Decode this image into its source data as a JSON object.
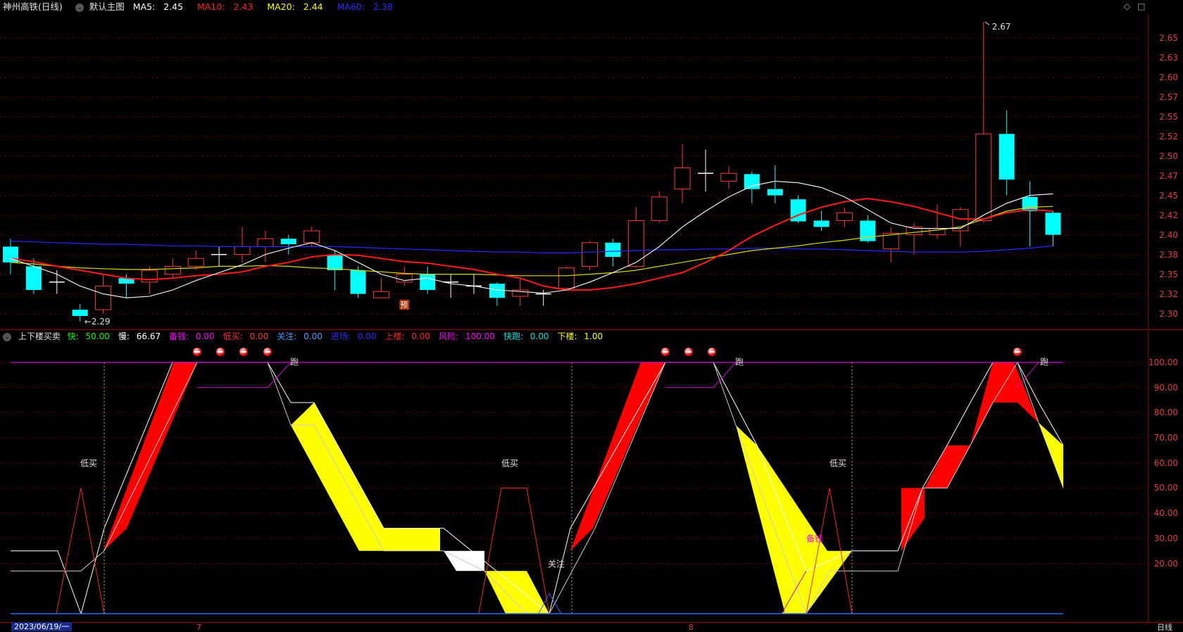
{
  "header": {
    "stock_name": "神州高铁(日线)",
    "main_chart_label": "默认主图",
    "ma": [
      {
        "label": "MA5:",
        "value": "2.45",
        "color": "#ffffff"
      },
      {
        "label": "MA10:",
        "value": "2.43",
        "color": "#ff2020"
      },
      {
        "label": "MA20:",
        "value": "2.44",
        "color": "#ffff00"
      },
      {
        "label": "MA60:",
        "value": "2.38",
        "color": "#2a2aff"
      }
    ],
    "window_icons": [
      "diamond-icon",
      "square-icon"
    ]
  },
  "price_axis": {
    "ticks": [
      "2.65",
      "2.63",
      "2.60",
      "2.57",
      "2.55",
      "2.52",
      "2.50",
      "2.47",
      "2.45",
      "2.42",
      "2.40",
      "2.38",
      "2.35",
      "2.32",
      "2.30"
    ],
    "tick_values": [
      2.65,
      2.625,
      2.6,
      2.575,
      2.55,
      2.525,
      2.5,
      2.475,
      2.45,
      2.425,
      2.4,
      2.375,
      2.35,
      2.325,
      2.3
    ],
    "high_label": "2.67",
    "low_label": "2.29",
    "preview_badge": "预"
  },
  "indicator": {
    "name": "上下楼买卖",
    "params": [
      {
        "label": "快:",
        "value": "50.00",
        "color": "#00ff00"
      },
      {
        "label": "慢:",
        "value": "66.67",
        "color": "#ffffff"
      },
      {
        "label": "备钱:",
        "value": "0.00",
        "color": "#ff00ff"
      },
      {
        "label": "低买:",
        "value": "0.00",
        "color": "#ff3030"
      },
      {
        "label": "关注:",
        "value": "0.00",
        "color": "#40a0ff"
      },
      {
        "label": "进场:",
        "value": "0.00",
        "color": "#2a2aff"
      },
      {
        "label": "上楼:",
        "value": "0.00",
        "color": "#ff2020"
      },
      {
        "label": "风险:",
        "value": "100.00",
        "color": "#ff00ff"
      },
      {
        "label": "快跑:",
        "value": "0.00",
        "color": "#00e0e0"
      },
      {
        "label": "下楼:",
        "value": "1.00",
        "color": "#ffff00"
      }
    ],
    "axis_ticks": [
      "100.00",
      "90.00",
      "80.00",
      "70.00",
      "60.00",
      "50.00",
      "40.00",
      "30.00",
      "20.00"
    ],
    "axis_values": [
      100,
      90,
      80,
      70,
      60,
      50,
      40,
      30,
      20
    ],
    "annotations": {
      "run": "跑",
      "low_buy": "低买",
      "watch": "关注",
      "prepare": "备钱"
    }
  },
  "footer": {
    "date": "2023/06/19/一",
    "month_7": "7",
    "month_8": "8",
    "period": "日线"
  },
  "chart_data": {
    "type": "candlestick",
    "title": "神州高铁(日线)",
    "candles": [
      {
        "o": 2.385,
        "c": 2.365,
        "h": 2.395,
        "l": 2.35
      },
      {
        "o": 2.36,
        "c": 2.33,
        "h": 2.37,
        "l": 2.325
      },
      {
        "o": 2.34,
        "c": 2.34,
        "h": 2.355,
        "l": 2.325
      },
      {
        "o": 2.305,
        "c": 2.297,
        "h": 2.312,
        "l": 2.29
      },
      {
        "o": 2.305,
        "c": 2.335,
        "h": 2.35,
        "l": 2.3
      },
      {
        "o": 2.345,
        "c": 2.338,
        "h": 2.35,
        "l": 2.32
      },
      {
        "o": 2.34,
        "c": 2.355,
        "h": 2.36,
        "l": 2.325
      },
      {
        "o": 2.35,
        "c": 2.36,
        "h": 2.37,
        "l": 2.345
      },
      {
        "o": 2.36,
        "c": 2.37,
        "h": 2.38,
        "l": 2.355
      },
      {
        "o": 2.375,
        "c": 2.375,
        "h": 2.385,
        "l": 2.36
      },
      {
        "o": 2.375,
        "c": 2.385,
        "h": 2.41,
        "l": 2.365
      },
      {
        "o": 2.385,
        "c": 2.395,
        "h": 2.405,
        "l": 2.365
      },
      {
        "o": 2.395,
        "c": 2.388,
        "h": 2.4,
        "l": 2.375
      },
      {
        "o": 2.39,
        "c": 2.405,
        "h": 2.41,
        "l": 2.385
      },
      {
        "o": 2.375,
        "c": 2.355,
        "h": 2.38,
        "l": 2.33
      },
      {
        "o": 2.355,
        "c": 2.325,
        "h": 2.36,
        "l": 2.32
      },
      {
        "o": 2.32,
        "c": 2.328,
        "h": 2.345,
        "l": 2.32
      },
      {
        "o": 2.34,
        "c": 2.35,
        "h": 2.36,
        "l": 2.335
      },
      {
        "o": 2.35,
        "c": 2.33,
        "h": 2.36,
        "l": 2.325
      },
      {
        "o": 2.34,
        "c": 2.34,
        "h": 2.35,
        "l": 2.32
      },
      {
        "o": 2.335,
        "c": 2.335,
        "h": 2.35,
        "l": 2.325
      },
      {
        "o": 2.338,
        "c": 2.32,
        "h": 2.34,
        "l": 2.31
      },
      {
        "o": 2.322,
        "c": 2.33,
        "h": 2.345,
        "l": 2.31
      },
      {
        "o": 2.325,
        "c": 2.325,
        "h": 2.33,
        "l": 2.31
      },
      {
        "o": 2.332,
        "c": 2.358,
        "h": 2.36,
        "l": 2.33
      },
      {
        "o": 2.36,
        "c": 2.39,
        "h": 2.392,
        "l": 2.355
      },
      {
        "o": 2.39,
        "c": 2.372,
        "h": 2.395,
        "l": 2.36
      },
      {
        "o": 2.36,
        "c": 2.418,
        "h": 2.435,
        "l": 2.358
      },
      {
        "o": 2.418,
        "c": 2.448,
        "h": 2.455,
        "l": 2.415
      },
      {
        "o": 2.458,
        "c": 2.485,
        "h": 2.515,
        "l": 2.44
      },
      {
        "o": 2.478,
        "c": 2.478,
        "h": 2.508,
        "l": 2.455
      },
      {
        "o": 2.468,
        "c": 2.478,
        "h": 2.487,
        "l": 2.458
      },
      {
        "o": 2.477,
        "c": 2.458,
        "h": 2.48,
        "l": 2.44
      },
      {
        "o": 2.458,
        "c": 2.45,
        "h": 2.488,
        "l": 2.44
      },
      {
        "o": 2.445,
        "c": 2.417,
        "h": 2.45,
        "l": 2.415
      },
      {
        "o": 2.418,
        "c": 2.41,
        "h": 2.43,
        "l": 2.405
      },
      {
        "o": 2.418,
        "c": 2.428,
        "h": 2.434,
        "l": 2.41
      },
      {
        "o": 2.418,
        "c": 2.392,
        "h": 2.425,
        "l": 2.39
      },
      {
        "o": 2.382,
        "c": 2.402,
        "h": 2.41,
        "l": 2.365
      },
      {
        "o": 2.4,
        "c": 2.41,
        "h": 2.415,
        "l": 2.375
      },
      {
        "o": 2.4,
        "c": 2.408,
        "h": 2.438,
        "l": 2.395
      },
      {
        "o": 2.405,
        "c": 2.432,
        "h": 2.435,
        "l": 2.385
      },
      {
        "o": 2.418,
        "c": 2.528,
        "h": 2.67,
        "l": 2.415
      },
      {
        "o": 2.528,
        "c": 2.47,
        "h": 2.558,
        "l": 2.45
      },
      {
        "o": 2.448,
        "c": 2.43,
        "h": 2.468,
        "l": 2.385
      },
      {
        "o": 2.428,
        "c": 2.4,
        "h": 2.43,
        "l": 2.385
      }
    ],
    "ma5": [
      2.37,
      2.36,
      2.35,
      2.335,
      2.325,
      2.32,
      2.322,
      2.33,
      2.342,
      2.352,
      2.362,
      2.375,
      2.383,
      2.39,
      2.38,
      2.365,
      2.35,
      2.342,
      2.345,
      2.338,
      2.335,
      2.33,
      2.328,
      2.326,
      2.33,
      2.34,
      2.352,
      2.365,
      2.385,
      2.41,
      2.43,
      2.448,
      2.462,
      2.468,
      2.466,
      2.46,
      2.448,
      2.432,
      2.415,
      2.408,
      2.408,
      2.408,
      2.425,
      2.44,
      2.45,
      2.452
    ],
    "ma10": [
      2.37,
      2.366,
      2.36,
      2.355,
      2.35,
      2.345,
      2.343,
      2.345,
      2.348,
      2.35,
      2.353,
      2.36,
      2.365,
      2.372,
      2.375,
      2.374,
      2.37,
      2.366,
      2.364,
      2.36,
      2.356,
      2.35,
      2.345,
      2.335,
      2.33,
      2.33,
      2.333,
      2.338,
      2.345,
      2.352,
      2.365,
      2.38,
      2.398,
      2.412,
      2.425,
      2.435,
      2.442,
      2.446,
      2.442,
      2.436,
      2.428,
      2.42,
      2.42,
      2.428,
      2.432,
      2.43
    ],
    "ma20": [
      2.365,
      2.363,
      2.36,
      2.358,
      2.357,
      2.356,
      2.356,
      2.357,
      2.358,
      2.36,
      2.36,
      2.361,
      2.36,
      2.358,
      2.357,
      2.355,
      2.353,
      2.351,
      2.35,
      2.35,
      2.35,
      2.349,
      2.348,
      2.348,
      2.348,
      2.35,
      2.352,
      2.355,
      2.36,
      2.365,
      2.37,
      2.375,
      2.38,
      2.383,
      2.386,
      2.39,
      2.393,
      2.397,
      2.4,
      2.403,
      2.406,
      2.41,
      2.42,
      2.43,
      2.435,
      2.436
    ],
    "ma60": [
      2.392,
      2.391,
      2.39,
      2.389,
      2.388,
      2.388,
      2.387,
      2.386,
      2.386,
      2.385,
      2.385,
      2.385,
      2.385,
      2.385,
      2.385,
      2.384,
      2.383,
      2.382,
      2.381,
      2.38,
      2.379,
      2.378,
      2.378,
      2.377,
      2.377,
      2.378,
      2.379,
      2.38,
      2.381,
      2.381,
      2.382,
      2.382,
      2.383,
      2.383,
      2.382,
      2.382,
      2.381,
      2.38,
      2.379,
      2.378,
      2.378,
      2.378,
      2.379,
      2.381,
      2.383,
      2.386
    ],
    "ylim": [
      2.28,
      2.68
    ],
    "indicator_ylim": [
      0,
      105
    ]
  }
}
